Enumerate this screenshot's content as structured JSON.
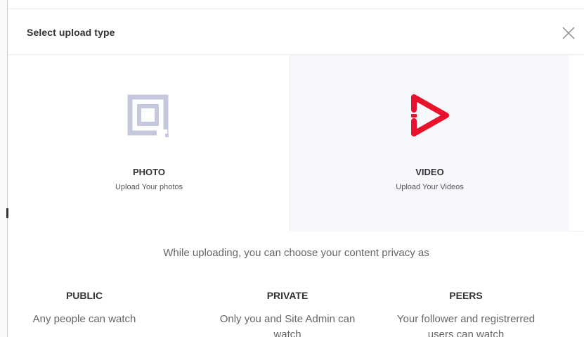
{
  "modal": {
    "title": "Select upload type",
    "close_icon": "close-icon"
  },
  "options": [
    {
      "label": "PHOTO",
      "sub": "Upload Your photos",
      "icon": "photo-icon",
      "icon_color": "#c5c8dd"
    },
    {
      "label": "VIDEO",
      "sub": "Upload Your Videos",
      "icon": "play-icon",
      "icon_color": "#e8122d"
    }
  ],
  "privacy": {
    "intro": "While uploading, you can choose your content privacy as",
    "items": [
      {
        "title": "PUBLIC",
        "desc": "Any people can watch"
      },
      {
        "title": "PRIVATE",
        "desc": "Only you and Site Admin can watch"
      },
      {
        "title": "PEERS",
        "desc": "Your follower and registrerred users can watch"
      }
    ]
  }
}
